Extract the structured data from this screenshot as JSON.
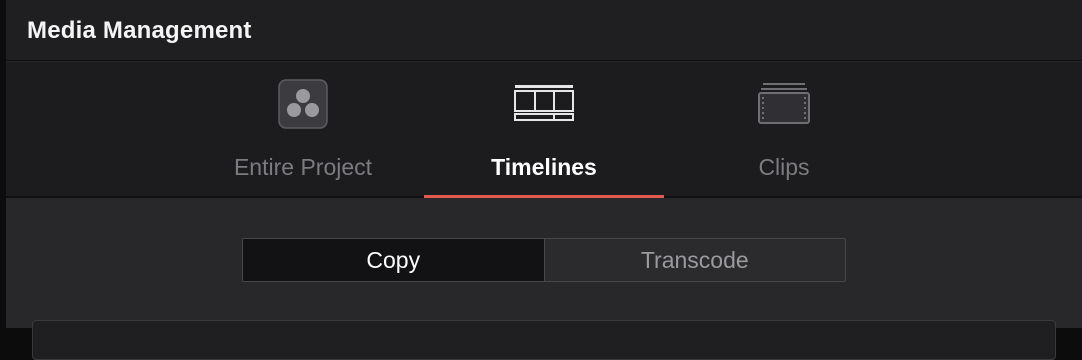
{
  "window": {
    "title": "Media Management"
  },
  "tabs": [
    {
      "label": "Entire Project",
      "icon": "resolve-logo-icon",
      "state": "inactive"
    },
    {
      "label": "Timelines",
      "icon": "timeline-icon",
      "state": "active"
    },
    {
      "label": "Clips",
      "icon": "clips-icon",
      "state": "inactive"
    }
  ],
  "mode_toggle": {
    "options": [
      "Copy",
      "Transcode"
    ],
    "selected": "Copy"
  },
  "colors": {
    "active_tab_underline": "#e5584f",
    "title_bar_bg": "#1f1f22",
    "panel_bg": "#28282b"
  }
}
